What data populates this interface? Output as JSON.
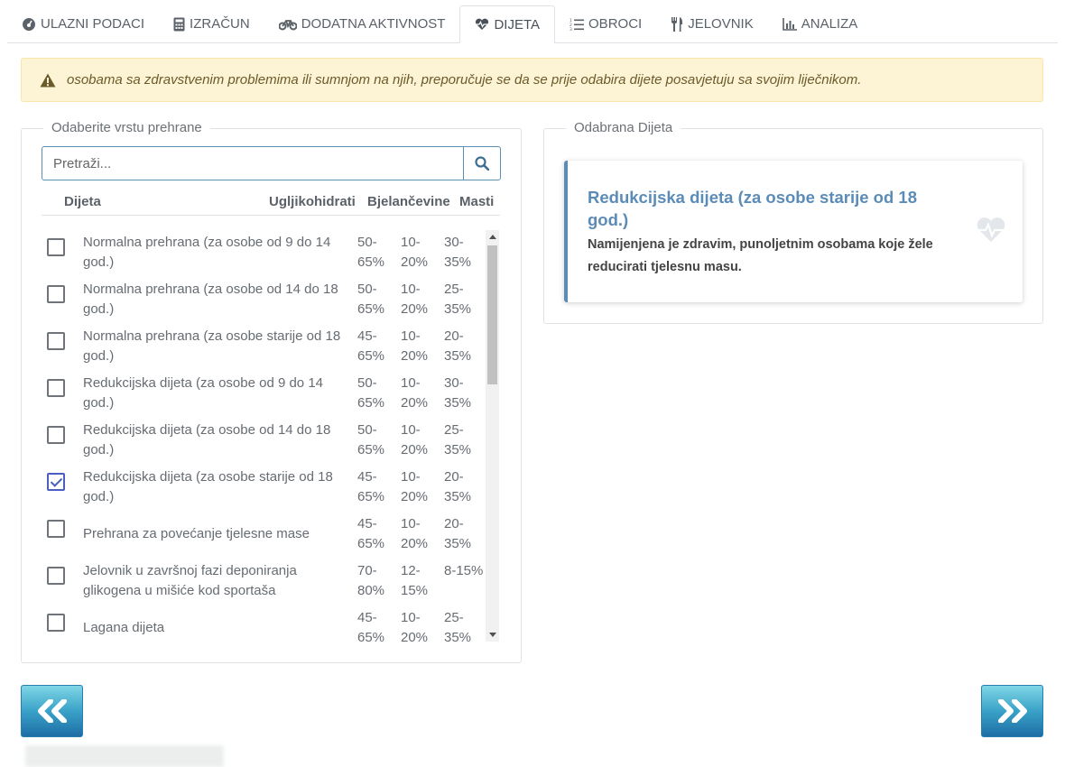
{
  "tabs": [
    {
      "label": "ULAZNI PODACI",
      "icon": "dashboard-icon"
    },
    {
      "label": "IZRAČUN",
      "icon": "calculator-icon"
    },
    {
      "label": "DODATNA AKTIVNOST",
      "icon": "bicycle-icon"
    },
    {
      "label": "DIJETA",
      "icon": "heart-pulse-icon"
    },
    {
      "label": "OBROCI",
      "icon": "list-ol-icon"
    },
    {
      "label": "JELOVNIK",
      "icon": "utensils-icon"
    },
    {
      "label": "ANALIZA",
      "icon": "bar-chart-icon"
    }
  ],
  "active_tab": "DIJETA",
  "alert": {
    "icon": "warning-icon",
    "text": "osobama sa zdravstvenim problemima ili sumnjom na njih, preporučuje se da se prije odabira dijete posavjetuju sa svojim liječnikom."
  },
  "diet_list": {
    "legend": "Odaberite vrstu prehrane",
    "search_placeholder": "Pretraži...",
    "columns": [
      "Dijeta",
      "Ugljikohidrati",
      "Bjelančevine",
      "Masti"
    ],
    "rows": [
      {
        "name": "Normalna prehrana (za osobe od 9 do 14 god.)",
        "carbs": "50-65%",
        "protein": "10-20%",
        "fat": "30-35%",
        "checked": false
      },
      {
        "name": "Normalna prehrana (za osobe od 14 do 18 god.)",
        "carbs": "50-65%",
        "protein": "10-20%",
        "fat": "25-35%",
        "checked": false
      },
      {
        "name": "Normalna prehrana (za osobe starije od 18 god.)",
        "carbs": "45-65%",
        "protein": "10-20%",
        "fat": "20-35%",
        "checked": false
      },
      {
        "name": "Redukcijska dijeta (za osobe od 9 do 14 god.)",
        "carbs": "50-65%",
        "protein": "10-20%",
        "fat": "30-35%",
        "checked": false
      },
      {
        "name": "Redukcijska dijeta (za osobe od 14 do 18 god.)",
        "carbs": "50-65%",
        "protein": "10-20%",
        "fat": "25-35%",
        "checked": false
      },
      {
        "name": "Redukcijska dijeta (za osobe starije od 18 god.)",
        "carbs": "45-65%",
        "protein": "10-20%",
        "fat": "20-35%",
        "checked": true
      },
      {
        "name": "Prehrana za povećanje tjelesne mase",
        "carbs": "45-65%",
        "protein": "10-20%",
        "fat": "20-35%",
        "checked": false
      },
      {
        "name": "Jelovnik u završnoj fazi deponiranja glikogena u mišiće kod sportaša",
        "carbs": "70-80%",
        "protein": "12-15%",
        "fat": "8-15%",
        "checked": false
      },
      {
        "name": "Lagana dijeta",
        "carbs": "45-65%",
        "protein": "10-20%",
        "fat": "25-35%",
        "checked": false
      }
    ]
  },
  "selected": {
    "legend": "Odabrana Dijeta",
    "title": "Redukcijska dijeta (za osobe starije od 18 god.)",
    "description": "Namijenjena je zdravim, punoljetnim osobama koje žele reducirati tjelesnu masu.",
    "icon": "heart-pulse-icon"
  },
  "colors": {
    "accent": "#5b8cb8",
    "checkbox_checked": "#4a5fc1",
    "alert_bg": "#fdf4d5",
    "nav_button_top": "#7fd6e6",
    "nav_button_bottom": "#1d6da6"
  }
}
